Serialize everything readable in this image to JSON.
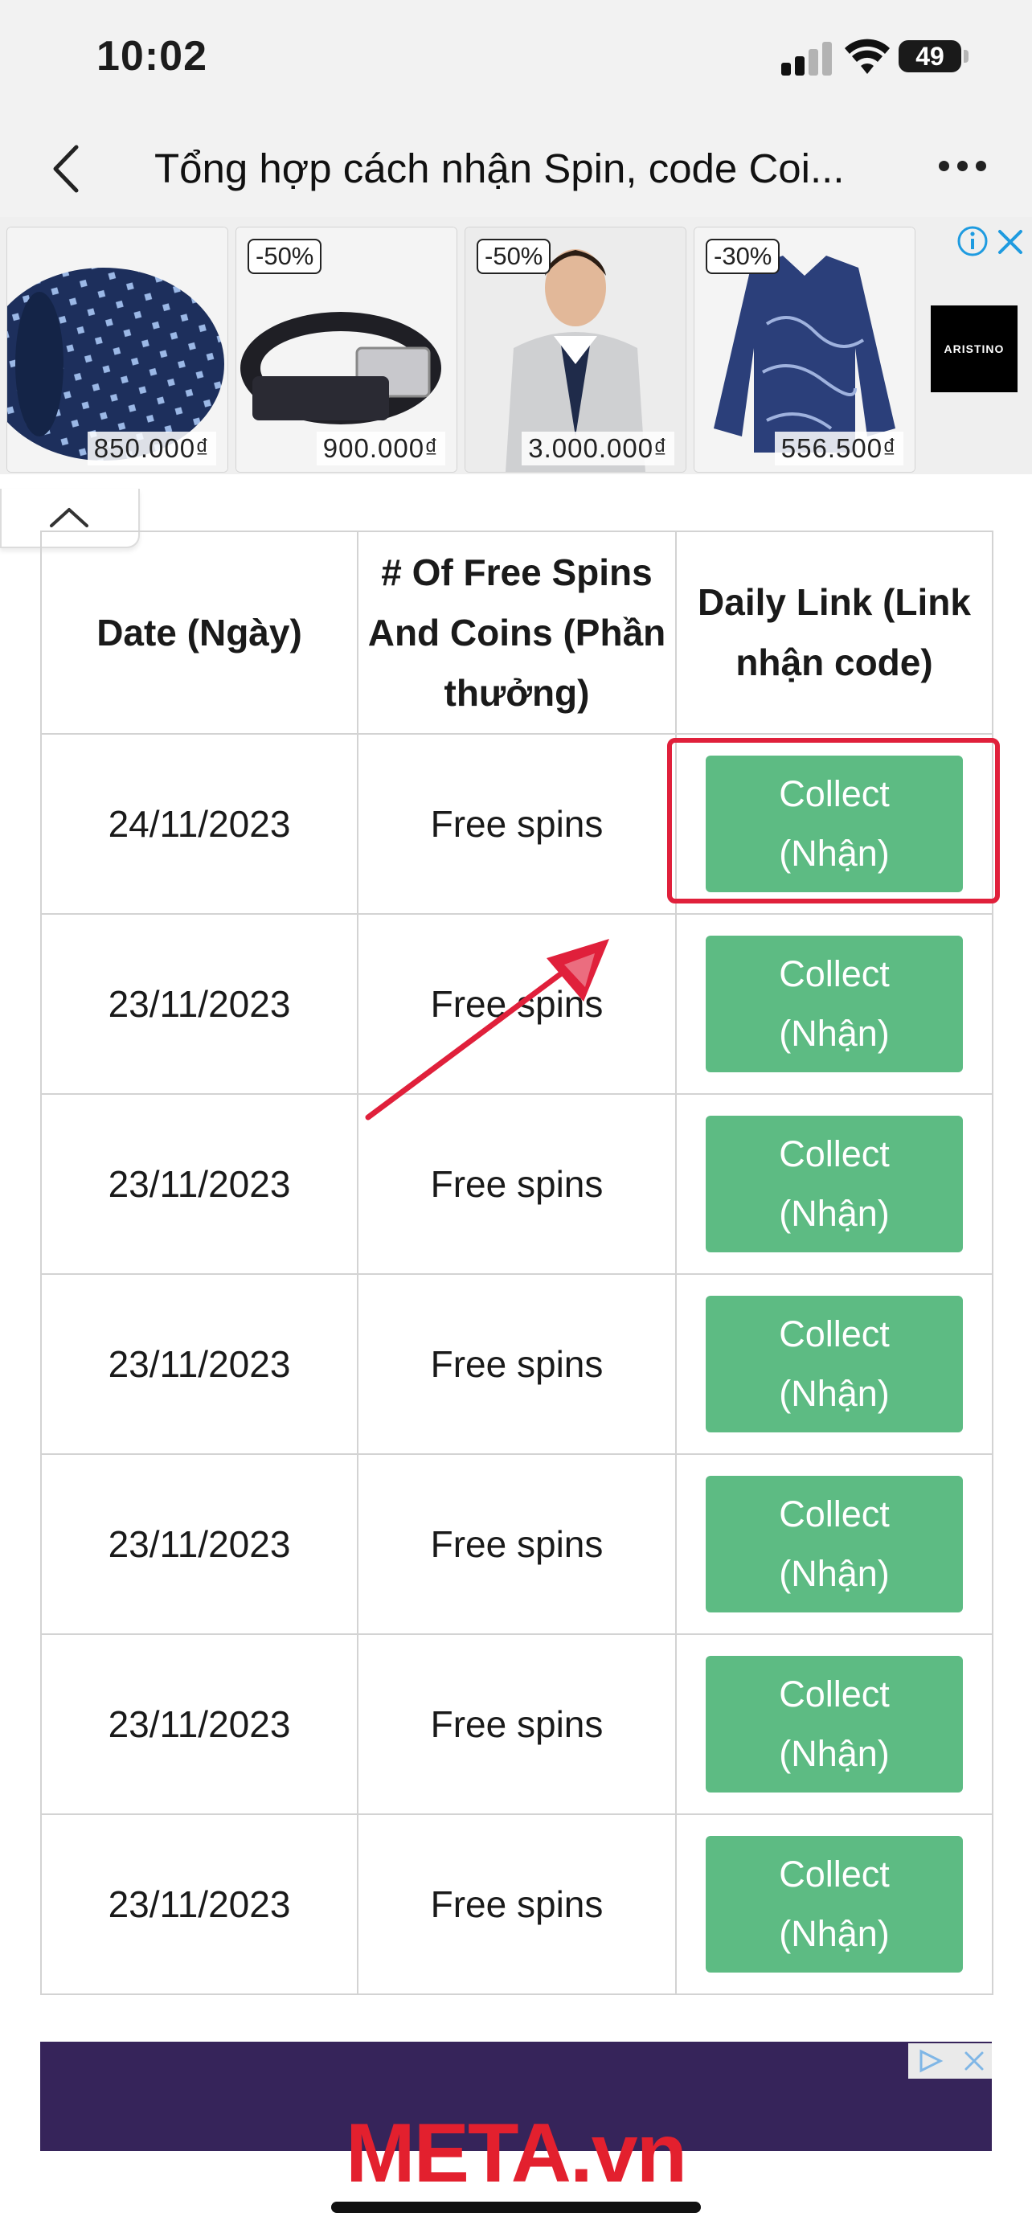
{
  "status_bar": {
    "time": "10:02",
    "battery": "49"
  },
  "nav": {
    "title": "Tổng hợp cách nhận Spin, code Coi...",
    "back_icon": "chevron-left-icon",
    "more_icon": "ellipsis-icon"
  },
  "ad_banner": {
    "items": [
      {
        "price": "850.000₫",
        "discount": "",
        "product": "tie"
      },
      {
        "price": "900.000₫",
        "discount": "-50%",
        "product": "belt"
      },
      {
        "price": "3.000.000₫",
        "discount": "-50%",
        "product": "suit"
      },
      {
        "price": "556.500₫",
        "discount": "-30%",
        "product": "shirt"
      }
    ],
    "brand": "ARISTINO",
    "info_icon": "info-icon",
    "close_icon": "close-icon",
    "collapse_icon": "chevron-up-icon"
  },
  "table": {
    "headers": [
      "Date (Ngày)",
      "# Of Free Spins And Coins (Phần thưởng)",
      "Daily Link (Link nhận code)"
    ],
    "rows": [
      {
        "date": "24/11/2023",
        "reward": "Free spins",
        "button_line1": "Collect",
        "button_line2": "(Nhận)"
      },
      {
        "date": "23/11/2023",
        "reward": "Free spins",
        "button_line1": "Collect",
        "button_line2": "(Nhận)"
      },
      {
        "date": "23/11/2023",
        "reward": "Free spins",
        "button_line1": "Collect",
        "button_line2": "(Nhận)"
      },
      {
        "date": "23/11/2023",
        "reward": "Free spins",
        "button_line1": "Collect",
        "button_line2": "(Nhận)"
      },
      {
        "date": "23/11/2023",
        "reward": "Free spins",
        "button_line1": "Collect",
        "button_line2": "(Nhận)"
      },
      {
        "date": "23/11/2023",
        "reward": "Free spins",
        "button_line1": "Collect",
        "button_line2": "(Nhận)"
      },
      {
        "date": "23/11/2023",
        "reward": "Free spins",
        "button_line1": "Collect",
        "button_line2": "(Nhận)"
      }
    ]
  },
  "bottom": {
    "watermark": "META.vn"
  },
  "colors": {
    "button_green": "#5dbb83",
    "highlight_red": "#e0203b",
    "ad_purple": "#36245a"
  }
}
